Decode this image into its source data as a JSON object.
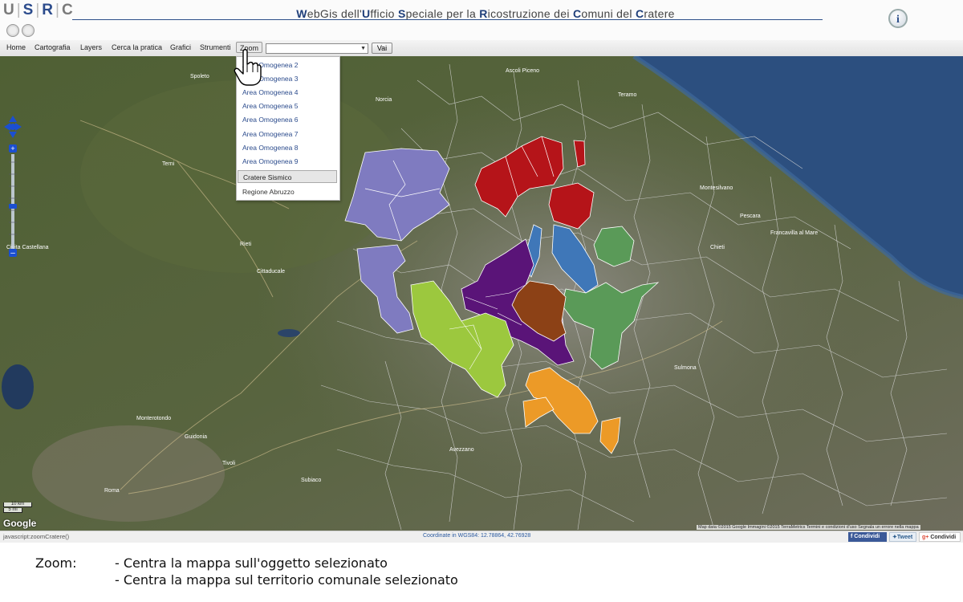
{
  "header": {
    "logo_letters": [
      "U",
      "S",
      "R",
      "C"
    ],
    "title": "WebGis dell'Ufficio Speciale per la Ricostruzione dei Comuni del Cratere",
    "info_icon": "info-icon"
  },
  "menubar": {
    "items": [
      "Home",
      "Cartografia",
      "Layers",
      "Cerca la pratica",
      "Grafici",
      "Strumenti",
      "Zoom"
    ],
    "active": "Zoom",
    "select_value": "",
    "go_label": "Vai"
  },
  "zoom_dropdown": {
    "items": [
      "Area Omogenea 2",
      "Area Omogenea 3",
      "Area Omogenea 4",
      "Area Omogenea 5",
      "Area Omogenea 6",
      "Area Omogenea 7",
      "Area Omogenea 8",
      "Area Omogenea 9",
      "Cratere Sismico",
      "Regione Abruzzo"
    ],
    "selected": "Cratere Sismico"
  },
  "map": {
    "scale": {
      "km": "10 km",
      "mi": "5 mi"
    },
    "google_logo": "Google",
    "attribution": "Map data ©2015 Google Immagini ©2015 TerraMetrics  Termini e condizioni d'uso  Segnala un errore nella mappa",
    "places": [
      "Spoleto",
      "Terni",
      "Rieti",
      "Roma",
      "Tivoli",
      "Guidonia",
      "Monterotondo",
      "Civita Castellana",
      "Teramo",
      "Pescara",
      "Avezzano",
      "Sulmona",
      "Chieti",
      "Montesilvano",
      "Francavilla al Mare",
      "Cittaducale",
      "Subiaco",
      "Norcia",
      "Ascoli Piceno"
    ],
    "colors": {
      "area_purple_light": "#7f7bc0",
      "area_red": "#b51419",
      "area_blue": "#3f77b8",
      "area_green": "#5a9a58",
      "area_purple_dark": "#5a1478",
      "area_brown": "#8c4116",
      "area_lime": "#9cc83e",
      "area_orange": "#ec9a27",
      "sea": "#2c4f7f"
    }
  },
  "statusbar": {
    "js_text": "javascript:zoomCratere()",
    "coords": "Coordinate in WGS84: 12.78864, 42.76928",
    "social": [
      "Condividi",
      "Tweet",
      "Condividi"
    ]
  },
  "caption": {
    "label": "Zoom:",
    "lines": [
      "- Centra la mappa sull'oggetto selezionato",
      "- Centra la mappa sul territorio comunale selezionato"
    ]
  }
}
